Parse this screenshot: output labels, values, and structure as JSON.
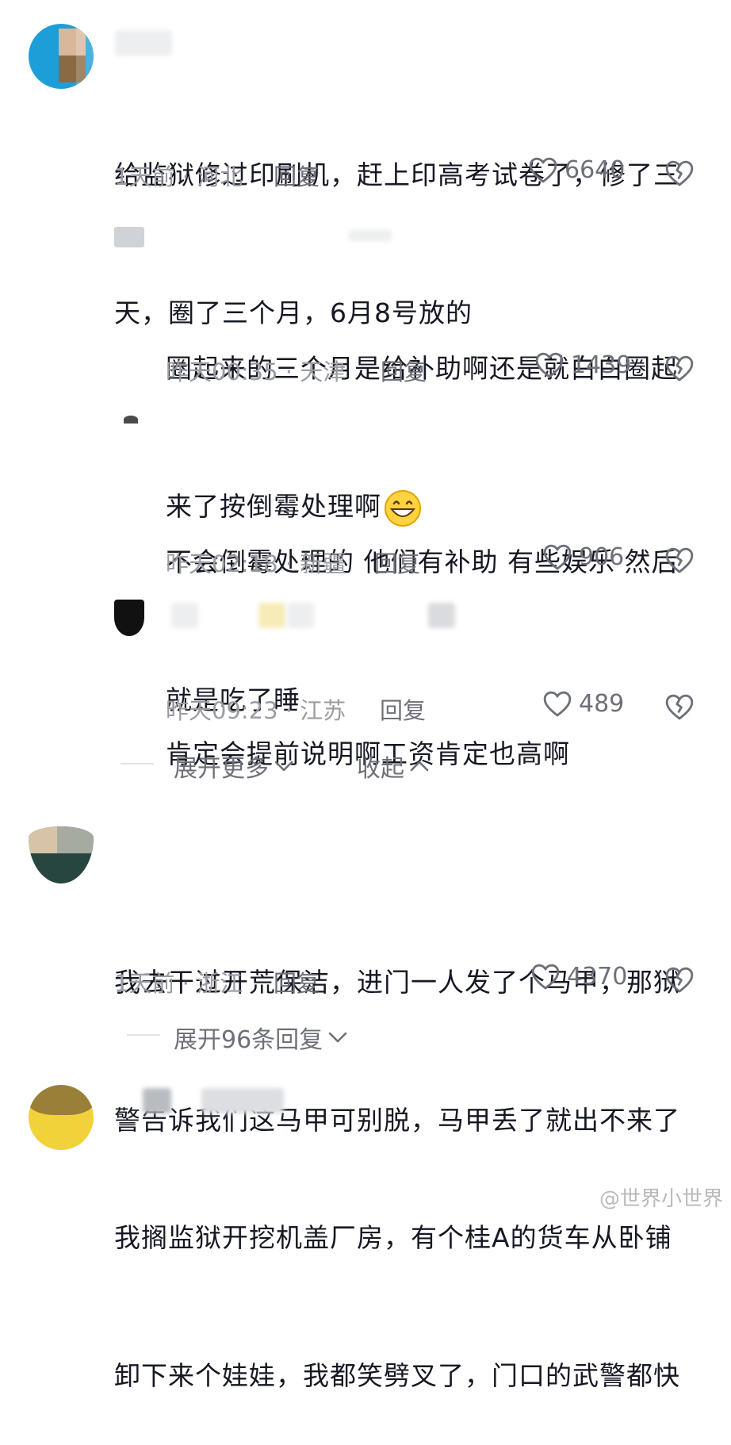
{
  "comments": [
    {
      "text_lines": [
        "给监狱修过印刷机，赶上印高考试卷了，修了三",
        "天，圈了三个月，6月8号放的"
      ],
      "time_location": "1天前 · 河北",
      "reply_label": "回复",
      "likes": "6640",
      "avatar_colors": [
        "#d9b79b",
        "#8a6a44",
        "#1e9ed8"
      ]
    },
    {
      "text_lines": [
        "圈起来的三个月是给补助啊还是就白白圈起",
        "来了按倒霉处理啊"
      ],
      "time_location": "昨天00:35 · 天津",
      "reply_label": "回复",
      "likes": "1439"
    },
    {
      "text_lines": [
        "不会倒霉处理的 他们有补助 有些娱乐 然后",
        "就是吃了睡"
      ],
      "time_location": "昨天02:18 · 新疆",
      "reply_label": "回复",
      "likes": "906"
    },
    {
      "text_lines": [
        "肯定会提前说明啊工资肯定也高啊"
      ],
      "time_location": "昨天09:23 · 江苏",
      "reply_label": "回复",
      "likes": "489"
    },
    {
      "text_lines": [
        "我去干过开荒保洁，进门一人发了个马甲，那狱",
        "警告诉我们这马甲可别脱，马甲丢了就出不来了"
      ],
      "time_location": "1天前 · 浙江",
      "reply_label": "回复",
      "likes": "4370"
    },
    {
      "text_lines": [
        "我搁监狱开挖机盖厂房，有个桂A的货车从卧铺",
        "卸下来个娃娃，我都笑劈叉了，门口的武警都快"
      ]
    }
  ],
  "thread_controls": {
    "expand_more": "展开更多",
    "collapse": "收起",
    "expand_replies": "展开96条回复"
  },
  "icons": {
    "like": "heart-outline-icon",
    "dislike": "broken-heart-icon",
    "chevron_down": "chevron-down-icon",
    "chevron_up": "chevron-up-icon",
    "emoji": "grin-emoji-icon"
  },
  "watermark": "@世界小世界"
}
